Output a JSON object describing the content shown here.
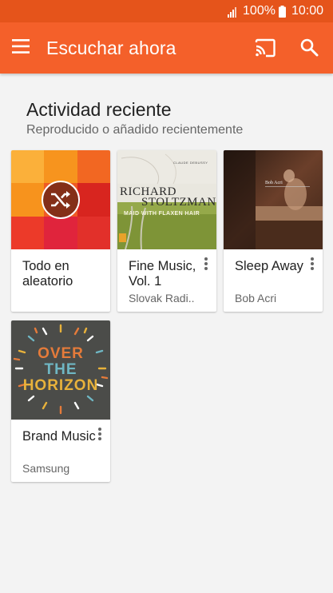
{
  "status_bar": {
    "battery_text": "100%",
    "time": "10:00"
  },
  "toolbar": {
    "title": "Escuchar ahora",
    "icons": [
      "menu-icon",
      "cast-icon",
      "search-icon"
    ]
  },
  "recent": {
    "title": "Actividad reciente",
    "subtitle": "Reproducido o añadido recientemente"
  },
  "cards": [
    {
      "title": "Todo en aleatorio",
      "subtitle": "",
      "has_menu": false,
      "art": "shuffle"
    },
    {
      "title": "Fine Music, Vol. 1",
      "subtitle": "Slovak Radi..",
      "has_menu": true,
      "art": "album-stoltzman",
      "art_text": {
        "composer": "CLAUDE DEBUSSY",
        "artist_line1": "RICHARD",
        "artist_line2": "STOLTZMAN",
        "album": "MAID WITH FLAXEN HAIR"
      }
    },
    {
      "title": "Sleep Away",
      "subtitle": "Bob Acri",
      "has_menu": true,
      "art": "album-piano"
    },
    {
      "title": "Brand Music",
      "subtitle": "Samsung",
      "has_menu": true,
      "art": "album-horizon",
      "art_text": {
        "line1": "OVER",
        "line2": "THE",
        "line3": "HORIZON"
      }
    }
  ],
  "colors": {
    "status_bar": "#e5541b",
    "toolbar": "#f4602a",
    "background": "#f3f3f3"
  }
}
